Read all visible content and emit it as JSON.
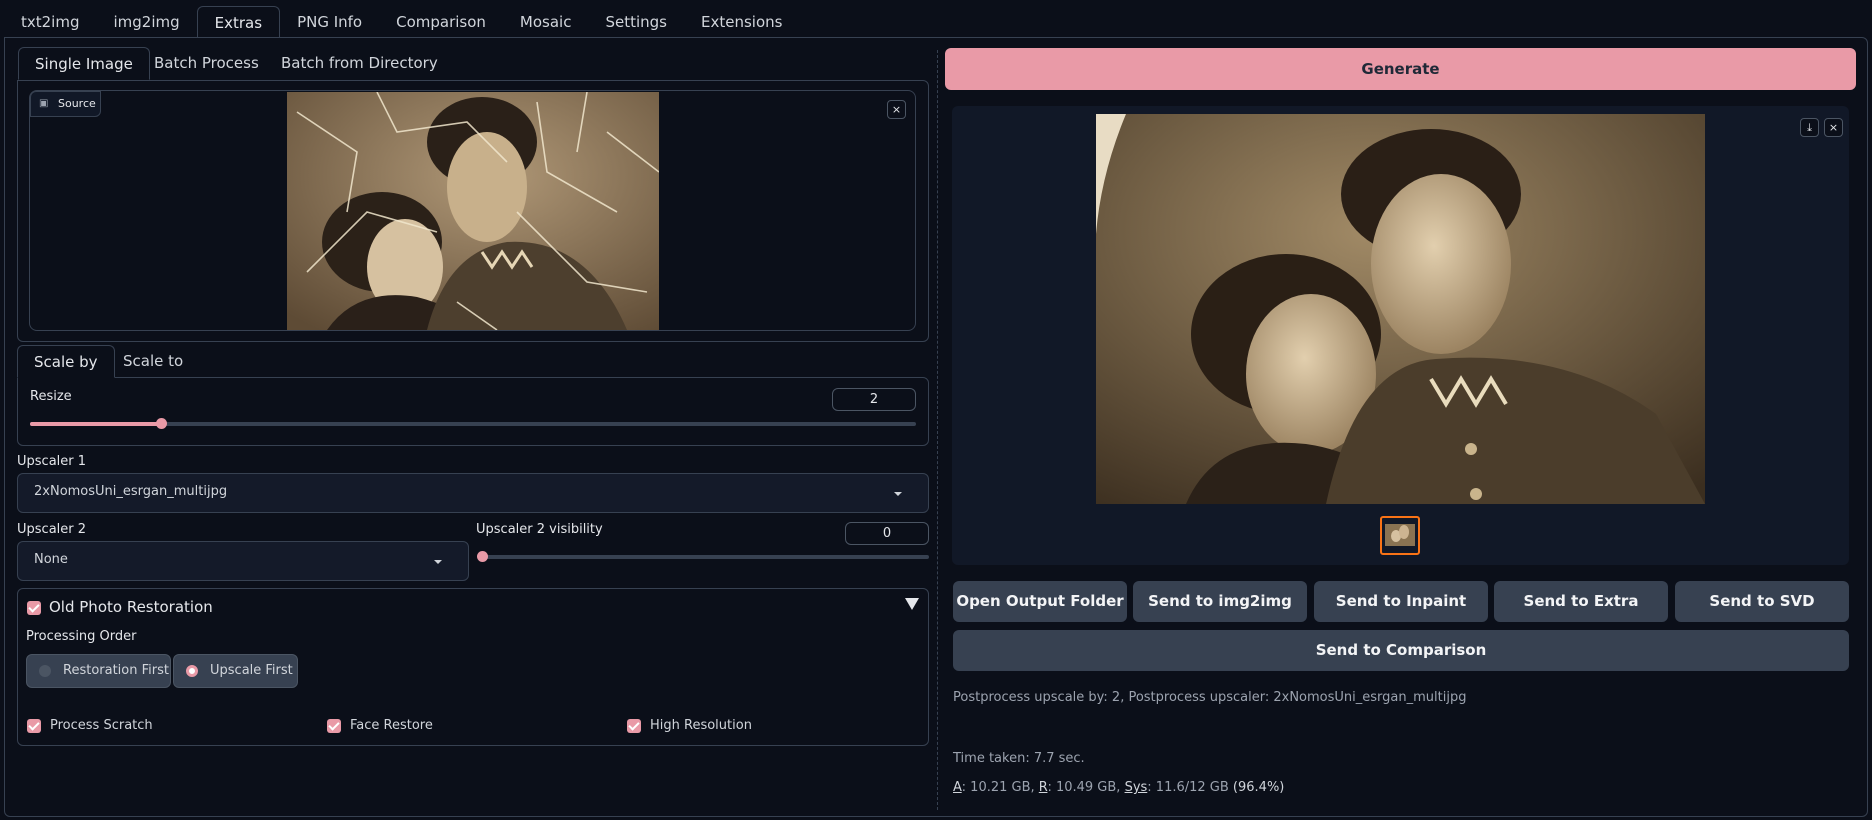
{
  "top_tabs": [
    "txt2img",
    "img2img",
    "Extras",
    "PNG Info",
    "Comparison",
    "Mosaic",
    "Settings",
    "Extensions"
  ],
  "sub_tabs": [
    "Single Image",
    "Batch Process",
    "Batch from Directory"
  ],
  "source": {
    "label": "Source",
    "close": "×"
  },
  "scale_tabs": [
    "Scale by",
    "Scale to"
  ],
  "resize": {
    "label": "Resize",
    "value": "2",
    "fraction": 0.148
  },
  "upscaler1": {
    "label": "Upscaler 1",
    "value": "2xNomosUni_esrgan_multijpg"
  },
  "upscaler2": {
    "label": "Upscaler 2",
    "value": "None"
  },
  "upscaler2_visibility": {
    "label": "Upscaler 2 visibility",
    "value": "0",
    "fraction": 0.0
  },
  "old_photo": {
    "title": "Old Photo Restoration",
    "processing_order_label": "Processing Order",
    "options": [
      "Restoration First",
      "Upscale First"
    ],
    "selected": "Upscale First",
    "checks": [
      "Process Scratch",
      "Face Restore",
      "High Resolution"
    ]
  },
  "generate_label": "Generate",
  "actions": [
    "Open Output Folder",
    "Send to img2img",
    "Send to Inpaint",
    "Send to Extra",
    "Send to SVD"
  ],
  "send_comparison": "Send to Comparison",
  "info": {
    "postprocess": "Postprocess upscale by: 2, Postprocess upscaler: 2xNomosUni_esrgan_multijpg",
    "time": "Time taken: 7.7 sec.",
    "mem_a_key": "A",
    "mem_a": ": 10.21 GB, ",
    "mem_r_key": "R",
    "mem_r": ": 10.49 GB, ",
    "mem_sys_key": "Sys",
    "mem_sys": ": 11.6/12 GB ",
    "mem_pct": "(96.4%)"
  },
  "colors": {
    "accent": "#e99aa7",
    "background": "#0b0f19",
    "border": "#374151",
    "button": "#374151",
    "thumb_border": "#f97316"
  },
  "icons": [
    "image-icon",
    "close-icon",
    "download-icon",
    "caret-down-icon",
    "collapse-triangle-icon"
  ]
}
